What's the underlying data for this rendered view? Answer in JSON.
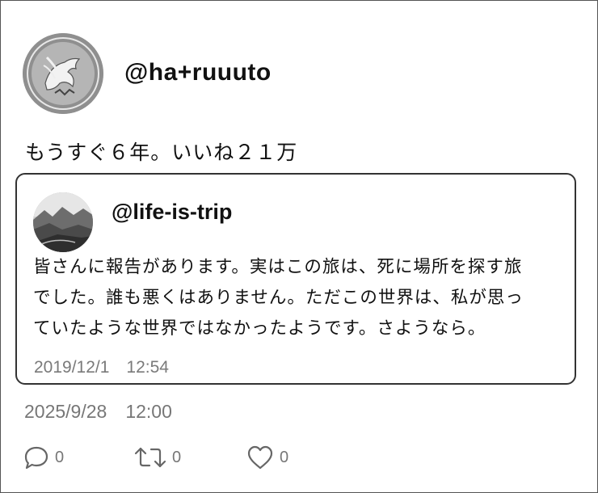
{
  "post": {
    "handle": "@ha+ruuuto",
    "text": "もうすぐ６年。いいね２１万",
    "timestamp": "2025/9/28　12:00"
  },
  "quoted": {
    "handle": "@life-is-trip",
    "lines": [
      "皆さんに報告があります。実はこの旅は、死に場所を探す旅",
      "でした。誰も悪くはありません。ただこの世界は、私が思っ",
      "ていたような世界ではなかったようです。さようなら。"
    ],
    "timestamp": "2019/12/1　12:54"
  },
  "actions": {
    "reply": {
      "icon": "reply-icon",
      "count": "0"
    },
    "retweet": {
      "icon": "retweet-icon",
      "count": "0"
    },
    "like": {
      "icon": "heart-icon",
      "count": "0"
    }
  },
  "colors": {
    "text": "#111111",
    "muted": "#777777",
    "border": "#333333"
  }
}
